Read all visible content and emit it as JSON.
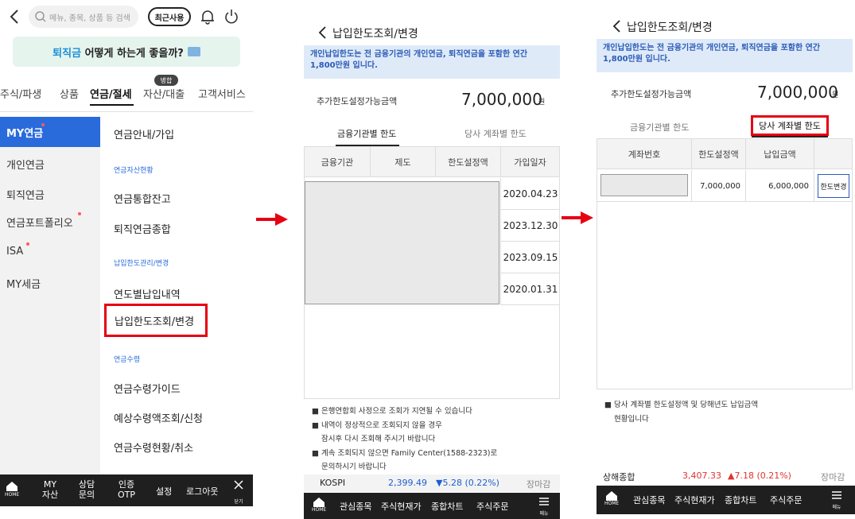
{
  "panel1": {
    "search_placeholder": "메뉴, 종목, 상품 등 검색",
    "recent_label": "최근사용",
    "banner_highlight": "퇴직금",
    "banner_text": " 어떻게 하는게 좋을까?",
    "nav_badge": "병합",
    "nav_tabs": [
      "주식/파생",
      "상품",
      "연금/절세",
      "자산/대출",
      "고객서비스"
    ],
    "side_items": [
      "MY연금",
      "개인연금",
      "퇴직연금",
      "연금포트폴리오",
      "ISA",
      "MY세금"
    ],
    "sections": [
      {
        "items": [
          "연금안내/가입"
        ]
      },
      {
        "header": "연금자산현황",
        "items": [
          "연금통합잔고",
          "퇴직연금종합"
        ]
      },
      {
        "header": "납입한도관리/변경",
        "items": [
          "연도별납입내역",
          "납입한도조회/변경"
        ]
      },
      {
        "header": "연금수령",
        "items": [
          "연금수령가이드",
          "예상수령액조회/신청",
          "연금수령현황/취소"
        ]
      }
    ],
    "bottom": {
      "home": "HOME",
      "my_asset_1": "MY",
      "my_asset_2": "자산",
      "consult_1": "상담",
      "consult_2": "문의",
      "cert_1": "인증",
      "cert_2": "OTP",
      "settings": "설정",
      "logout": "로그아웃",
      "close": "닫기"
    }
  },
  "panel2": {
    "title": "납입한도조회/변경",
    "notice": "개인납입한도는 전 금융기관의 개인연금, 퇴직연금을 포함한 연간 1,800만원 입니다.",
    "limit_label": "추가한도설정가능금액",
    "limit_value": "7,000,000",
    "unit": "원",
    "tabs": [
      "금융기관별 한도",
      "당사 계좌별 한도"
    ],
    "table_headers": [
      "금융기관",
      "제도",
      "한도설정액",
      "가입일자"
    ],
    "dates": [
      "2020.04.23",
      "2023.12.30",
      "2023.09.15",
      "2020.01.31"
    ],
    "notes": [
      "■ 은행연합회 사정으로 조회가 지연될 수 있습니다",
      "■ 내역이 정상적으로 조회되지 않을 경우",
      "잠시후 다시 조회해 주시기 바랍니다",
      "■ 계속 조회되지 않으면 Family Center(1588-2323)로",
      "문의하시기 바랍니다"
    ],
    "ticker": {
      "name": "KOSPI",
      "value": "2,399.49",
      "change": "▼5.28 (0.22%)",
      "status": "장마감"
    },
    "bottom": {
      "home": "HOME",
      "items": [
        "관심종목",
        "주식현재가",
        "종합차트",
        "주식주문"
      ],
      "menu": "메뉴"
    }
  },
  "panel3": {
    "title": "납입한도조회/변경",
    "notice": "개인납입한도는 전 금융기관의 개인연금, 퇴직연금을 포함한 연간 1,800만원 입니다.",
    "limit_label": "추가한도설정가능금액",
    "limit_value": "7,000,000",
    "unit": "원",
    "tabs": [
      "금융기관별 한도",
      "당사 계좌별 한도"
    ],
    "table_headers": [
      "계좌번호",
      "한도설정액",
      "납입금액"
    ],
    "row": {
      "limit": "7,000,000",
      "paid": "6,000,000",
      "button": "한도변경"
    },
    "notes": [
      "■ 당사 계좌별 한도설정액 및 당해년도 납입금액",
      "현황입니다"
    ],
    "ticker": {
      "name": "상해종합",
      "value": "3,407.33",
      "change": "▲7.18 (0.21%)",
      "status": "장마감"
    },
    "bottom": {
      "home": "HOME",
      "items": [
        "관심종목",
        "주식현재가",
        "종합차트",
        "주식주문"
      ],
      "menu": "메뉴"
    }
  },
  "colors": {
    "accent_red": "#e60012",
    "side_active": "#2a6bdc",
    "notice_bg": "#dfeaf8",
    "notice_text": "#2a5bb8",
    "bottom_bar": "#1f1f1f"
  }
}
